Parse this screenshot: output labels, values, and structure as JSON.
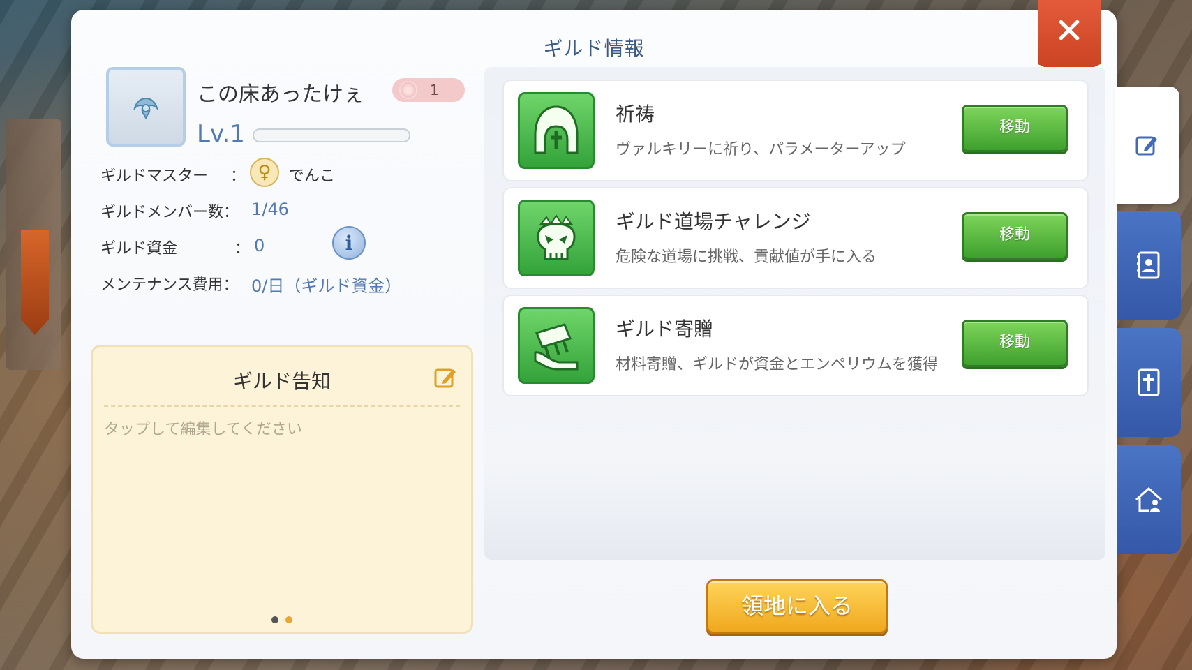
{
  "panel": {
    "title": "ギルド情報",
    "close_label": "✕"
  },
  "guild": {
    "name": "この床あったけぇ",
    "rank": "1",
    "level": "Lv.1",
    "level_progress": 0
  },
  "info": {
    "master_label": "ギルドマスター",
    "master_sep": "：",
    "master_value": "でんこ",
    "members_label": "ギルドメンバー数：",
    "members_value": "1/46",
    "funds_label": "ギルド資金",
    "funds_sep": "：",
    "funds_value": "0",
    "maintenance_label": "メンテナンス費用：",
    "maintenance_value": "0/日（ギルド資金）"
  },
  "notice": {
    "title": "ギルド告知",
    "placeholder": "タップして編集してください",
    "pages": 2,
    "active_page": 2
  },
  "activities": [
    {
      "title": "祈祷",
      "desc": "ヴァルキリーに祈り、パラメーターアップ",
      "button": "移動",
      "icon": "valkyrie-helmet-icon"
    },
    {
      "title": "ギルド道場チャレンジ",
      "desc": "危険な道場に挑戦、貢献値が手に入る",
      "button": "移動",
      "icon": "skull-crown-icon"
    },
    {
      "title": "ギルド寄贈",
      "desc": "材料寄贈、ギルドが資金とエンペリウムを獲得",
      "button": "移動",
      "icon": "donation-hand-icon"
    }
  ],
  "enter_button": "領地に入る",
  "side_tabs": [
    "edit-icon",
    "member-book-icon",
    "shield-cross-icon",
    "home-person-icon"
  ],
  "colors": {
    "accent_blue": "#5479b0",
    "button_green": "#3ea02e",
    "button_gold": "#f0a81e",
    "close_red": "#c7401f"
  }
}
